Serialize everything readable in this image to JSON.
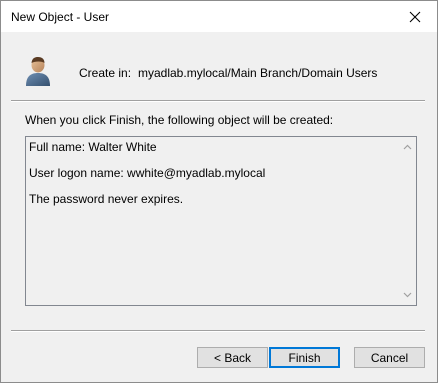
{
  "window": {
    "title": "New Object - User"
  },
  "header": {
    "create_in_label": "Create in:",
    "create_in_path": "myadlab.mylocal/Main Branch/Domain Users"
  },
  "main": {
    "intro_text": "When you click Finish, the following object will be created:",
    "summary_lines": [
      "Full name: Walter White",
      "User logon name: wwhite@myadlab.mylocal",
      "The password never expires."
    ]
  },
  "buttons": {
    "back_label": "< Back",
    "finish_label": "Finish",
    "cancel_label": "Cancel"
  },
  "icons": {
    "close": "close-icon",
    "user": "user-icon",
    "scroll_up": "scroll-up-arrow-icon",
    "scroll_down": "scroll-down-arrow-icon"
  },
  "colors": {
    "default_button_border": "#0078d7",
    "dialog_background": "#f0f0f0"
  }
}
